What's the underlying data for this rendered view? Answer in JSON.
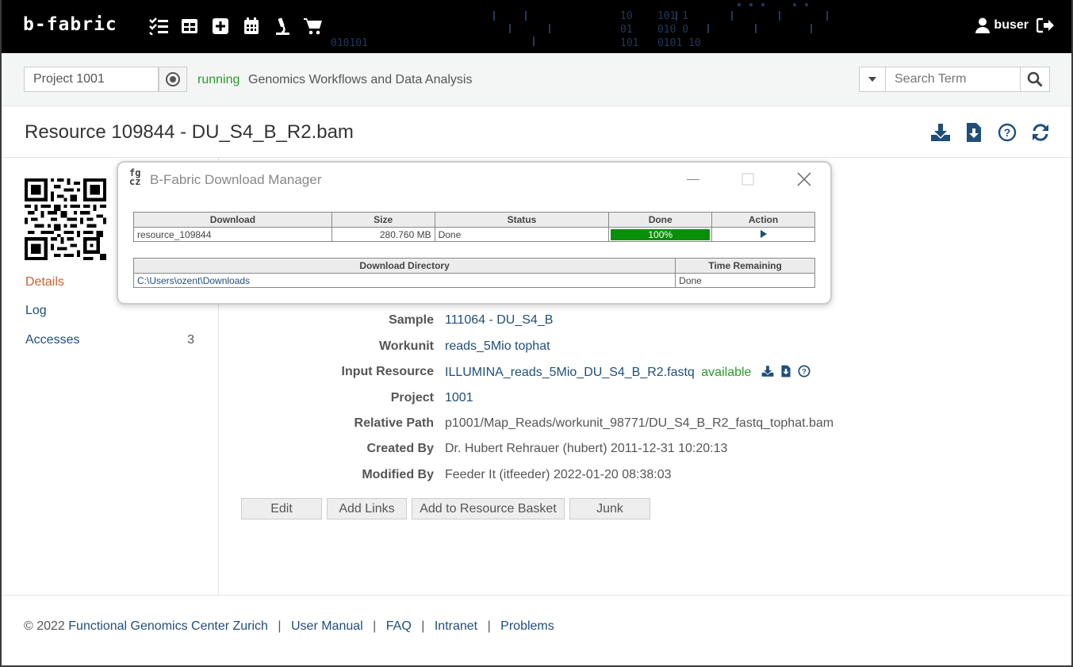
{
  "navbar": {
    "logo": "b-fabric",
    "user": "buser",
    "icons": [
      "tasks-icon",
      "table-icon",
      "plus-square-icon",
      "calendar-icon",
      "microscope-icon",
      "cart-icon"
    ],
    "bg_code": [
      "10    101 1",
      "01    010 0",
      "101   0101 10",
      "010101"
    ]
  },
  "project_bar": {
    "project_value": "Project 1001",
    "status": "running",
    "project_name": "Genomics Workflows and Data Analysis",
    "search_placeholder": "Search Term"
  },
  "title": "Resource 109844 - DU_S4_B_R2.bam",
  "sidebar": {
    "items": [
      {
        "label": "Details",
        "active": true
      },
      {
        "label": "Log"
      },
      {
        "label": "Accesses",
        "count": "3"
      }
    ]
  },
  "details": {
    "sample": {
      "label": "Sample",
      "value": "111064 - DU_S4_B"
    },
    "workunit": {
      "label": "Workunit",
      "value": "reads_5Mio tophat"
    },
    "input_resource": {
      "label": "Input Resource",
      "value": "ILLUMINA_reads_5Mio_DU_S4_B_R2.fastq",
      "status": "available"
    },
    "project": {
      "label": "Project",
      "value": "1001"
    },
    "relative_path": {
      "label": "Relative Path",
      "value": "p1001/Map_Reads/workunit_98771/DU_S4_B_R2_fastq_tophat.bam"
    },
    "created_by": {
      "label": "Created By",
      "value": "Dr. Hubert Rehrauer (hubert) 2011-12-31 10:20:13"
    },
    "modified_by": {
      "label": "Modified By",
      "value": "Feeder It (itfeeder) 2022-01-20 08:38:03"
    }
  },
  "buttons": {
    "edit": "Edit",
    "add_links": "Add Links",
    "add_basket": "Add to Resource Basket",
    "junk": "Junk"
  },
  "footer": {
    "copyright": "© 2022",
    "org": "Functional Genomics Center Zurich",
    "manual": "User Manual",
    "faq": "FAQ",
    "intranet": "Intranet",
    "problems": "Problems",
    "separator": "|"
  },
  "download_manager": {
    "logo": "fg\ncz",
    "title": "B-Fabric Download Manager",
    "headers": {
      "download": "Download",
      "size": "Size",
      "status": "Status",
      "done": "Done",
      "action": "Action"
    },
    "row": {
      "download": "resource_109844",
      "size": "280.760 MB",
      "status": "Done",
      "done": "100%",
      "progress_fraction": 1.0
    },
    "dir_headers": {
      "directory": "Download Directory",
      "time": "Time Remaining"
    },
    "dir_row": {
      "directory": "C:\\Users\\ozent\\Downloads",
      "time": "Done"
    }
  },
  "colors": {
    "accent": "#1f4e79",
    "active": "#c8602a",
    "running": "#2a9a2a",
    "progress": "#0a8f0a"
  }
}
